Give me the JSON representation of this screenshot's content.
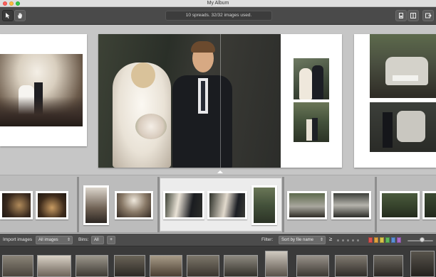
{
  "window": {
    "title": "My Album"
  },
  "toolbar": {
    "status": "10 spreads. 32/32 images used."
  },
  "bottom_bar": {
    "import_label": "Import images",
    "image_filter": "All images",
    "bins_label": "Bins:",
    "bins_value": "All",
    "bins_add": "+",
    "filter_label": "Filter:",
    "sort_value": "Sort by file name",
    "sort_direction": "≥"
  },
  "icons": {
    "arrow": "pointer-arrow-icon",
    "hand": "hand-pan-icon",
    "single_view": "single-page-view-icon",
    "spread_view": "spread-view-icon",
    "export": "export-icon"
  },
  "colors": {
    "swatches": [
      "#d9534f",
      "#e0a340",
      "#d6c24a",
      "#5cb85c",
      "#5b8fd6",
      "#a86cc9"
    ]
  }
}
